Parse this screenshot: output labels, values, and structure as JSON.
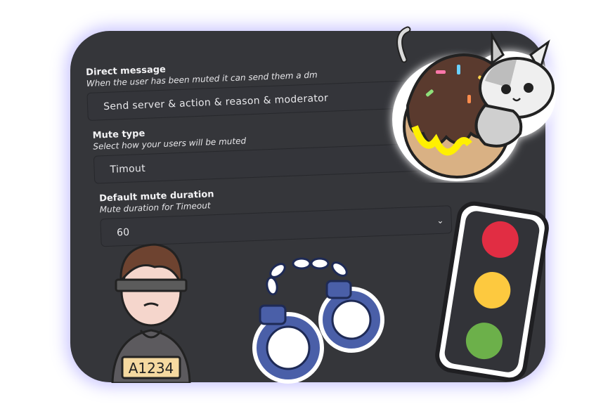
{
  "fields": [
    {
      "title": "Direct message",
      "description": "When the user has been muted it can send them a dm",
      "value": "Send server & action & reason & moderator"
    },
    {
      "title": "Mute type",
      "description": "Select how your users will be muted",
      "value": "Timout"
    },
    {
      "title": "Default mute duration",
      "description": "Mute duration for Timeout",
      "value": "60"
    }
  ],
  "icons": {
    "dropdown": "chevron-down-icon",
    "cat": "cat-donut-sticker",
    "prisoner": "prisoner-sticker",
    "handcuffs": "handcuffs-sticker",
    "traffic_light": "traffic-light-sticker"
  },
  "prisoner_plate": "A1234",
  "colors": {
    "panel_bg": "#35363a",
    "glow": "#8c82ff",
    "traffic_red": "#e12d43",
    "traffic_yellow": "#fdc93f",
    "traffic_green": "#6cb04a",
    "cuffs_blue": "#4a5fa8"
  }
}
